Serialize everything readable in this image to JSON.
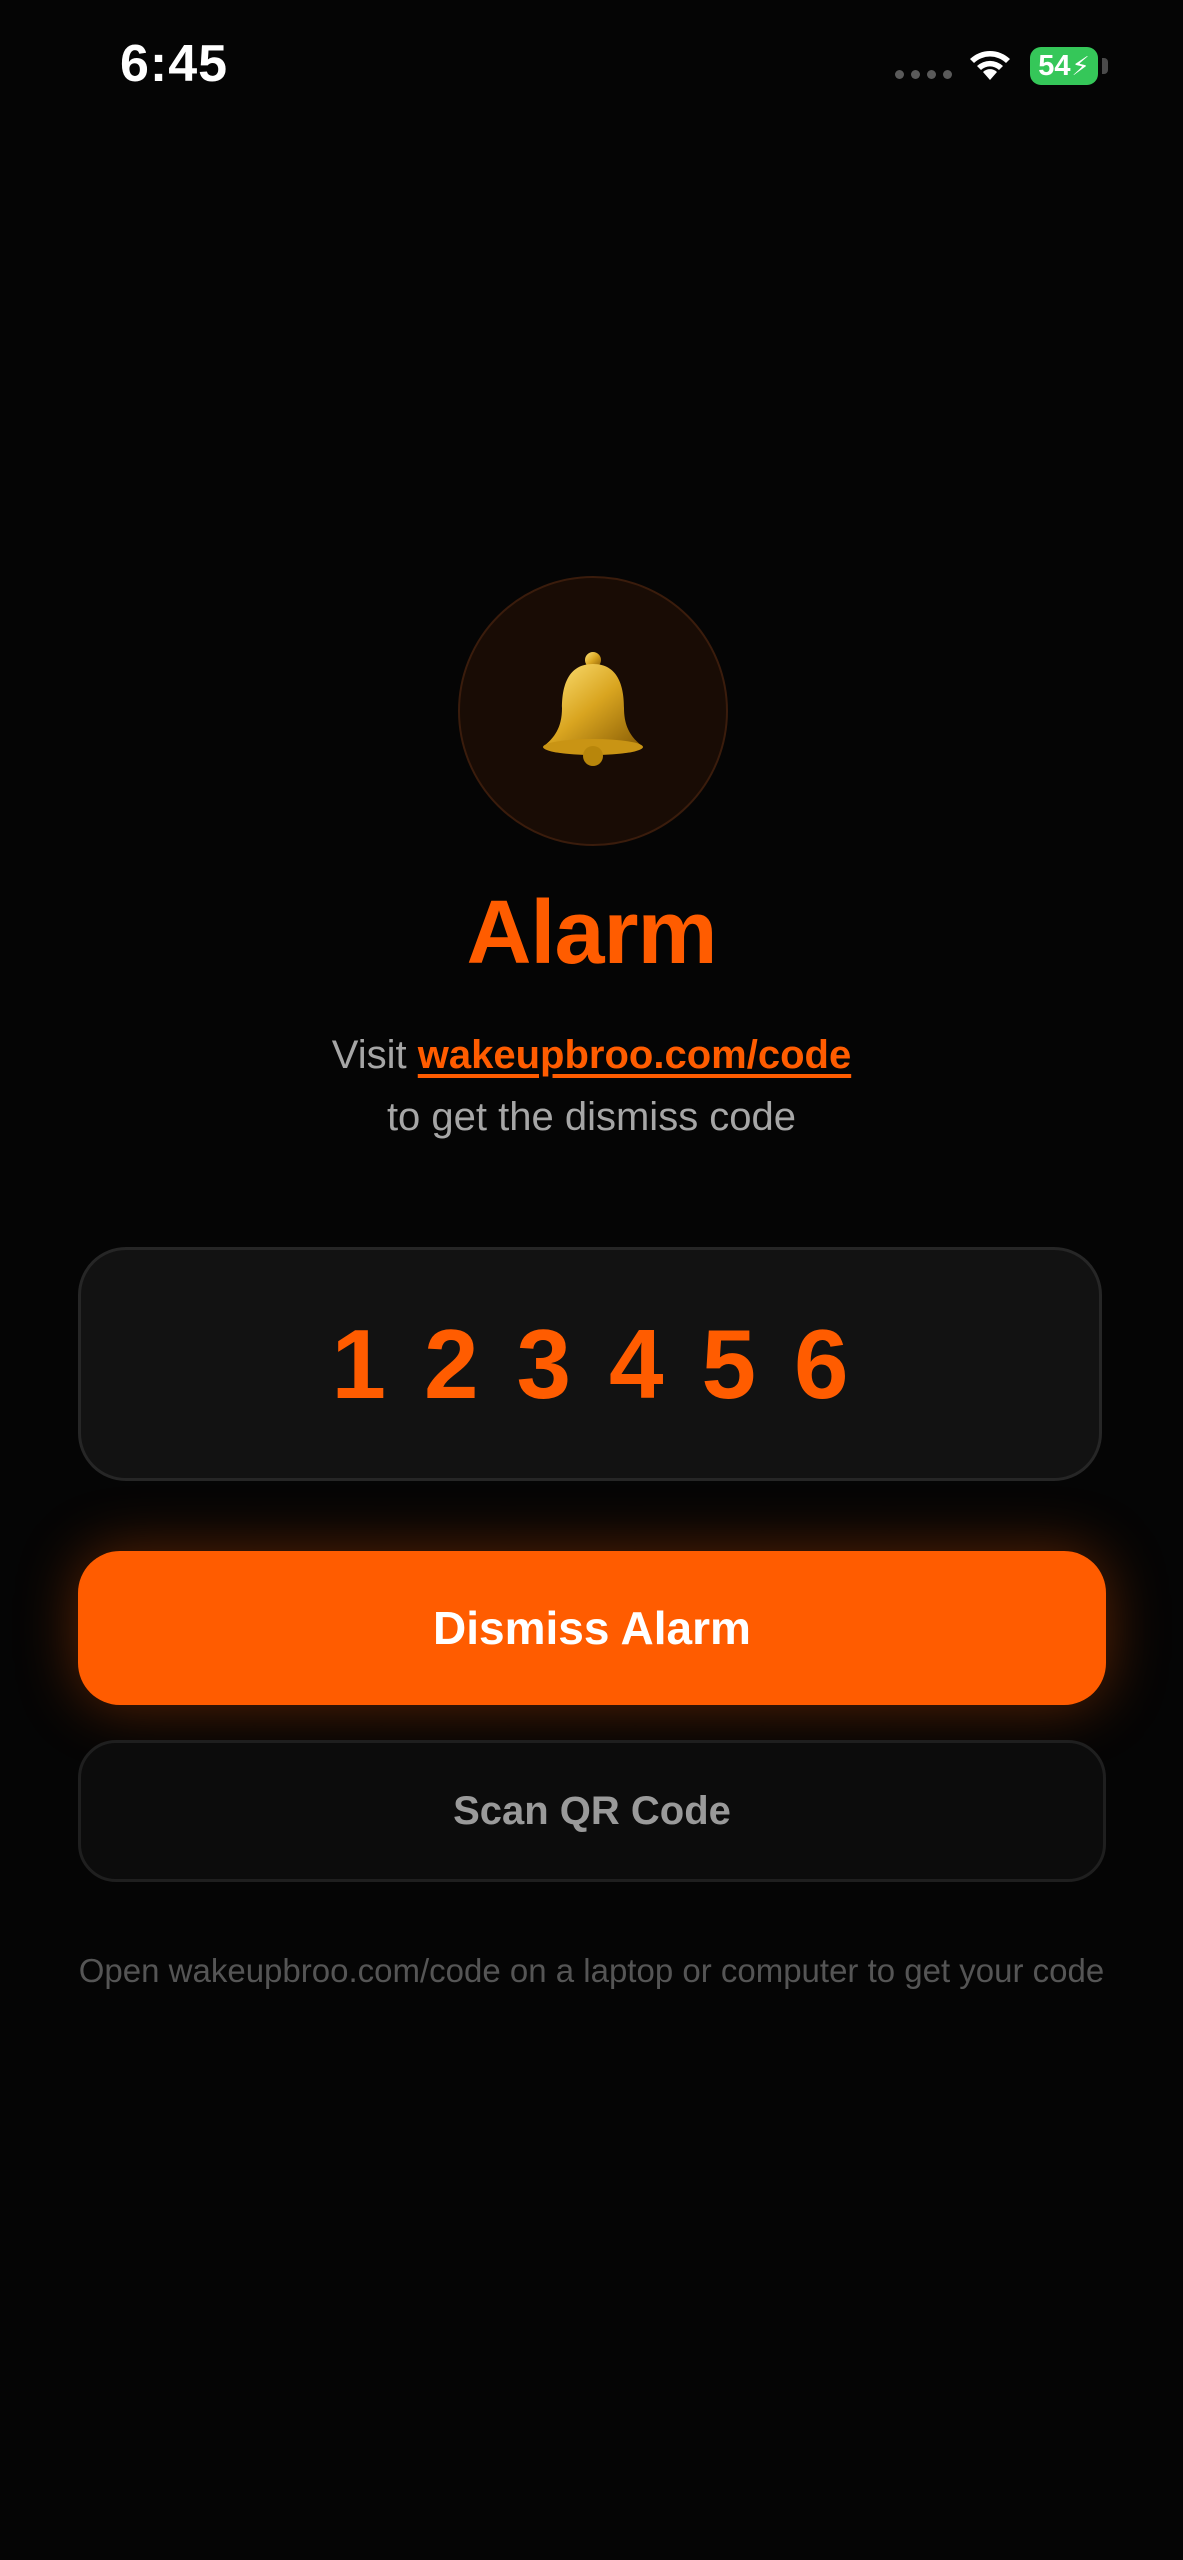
{
  "status_bar": {
    "time": "6:45",
    "battery": "54",
    "battery_color": "#35c759",
    "icons": [
      "signal-icon",
      "wifi-icon",
      "battery-icon",
      "charging-bolt-icon"
    ]
  },
  "alarm": {
    "icon": "bell-icon",
    "title": "Alarm",
    "visit_prefix": "Visit",
    "link": "wakeupbroo.com/code",
    "instruction_line2": "to get the dismiss code"
  },
  "code": {
    "digits": "123456"
  },
  "actions": {
    "dismiss_label": "Dismiss Alarm",
    "scan_label": "Scan QR Code"
  },
  "footer": {
    "note": "Open wakeupbroo.com/code on a laptop or computer to get your code"
  },
  "colors": {
    "accent": "#ff5c00",
    "background": "#050505",
    "card": "#121212"
  }
}
